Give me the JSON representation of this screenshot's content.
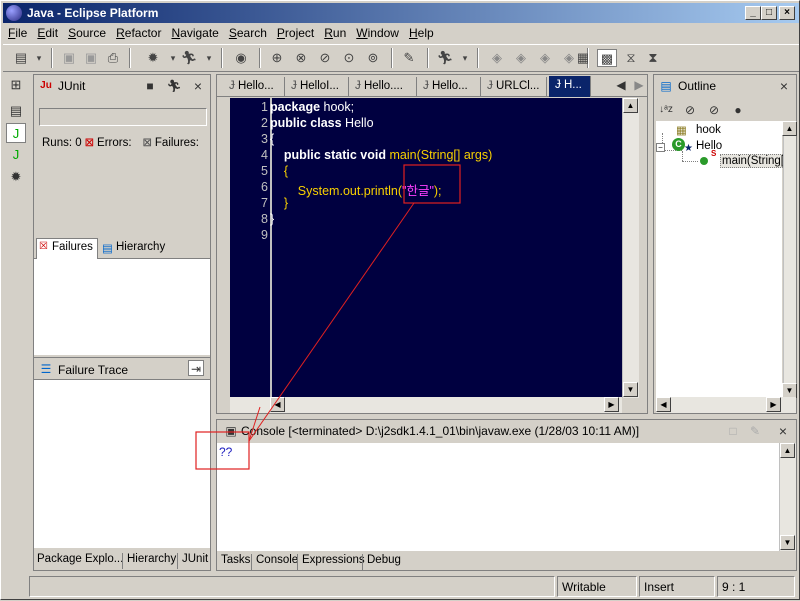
{
  "window": {
    "title": "Java - Eclipse Platform",
    "minimize_glyph": "_",
    "maximize_glyph": "□",
    "close_glyph": "×"
  },
  "menu": {
    "items": [
      "File",
      "Edit",
      "Source",
      "Refactor",
      "Navigate",
      "Search",
      "Project",
      "Run",
      "Window",
      "Help"
    ]
  },
  "junit": {
    "title": "JUnit",
    "runs_label": "Runs:",
    "runs_value": "0",
    "errors_label": "Errors:",
    "failures_label": "Failures:",
    "tab_failures": "Failures",
    "tab_hierarchy": "Hierarchy",
    "trace_title": "Failure Trace",
    "bottom_tabs": [
      "Package Explo...",
      "Hierarchy",
      "JUnit"
    ]
  },
  "editor": {
    "tabs": [
      "Hello...",
      "HelloI...",
      "Hello....",
      "Hello...",
      "URLCl...",
      "H..."
    ],
    "active_tab_index": 5,
    "lines": [
      {
        "num": "1",
        "kw": "package",
        "rest": " hook;"
      },
      {
        "num": "2",
        "kw": "public class",
        "rest": " Hello"
      },
      {
        "num": "3",
        "rest": "{"
      },
      {
        "num": "4",
        "indent": "    ",
        "kw": "public static void",
        "id": " main(String[] args)"
      },
      {
        "num": "5",
        "indent": "    ",
        "id": "{"
      },
      {
        "num": "6",
        "indent": "        ",
        "id": "System.out.println(",
        "str": "\"한글\"",
        "tail": ");"
      },
      {
        "num": "7",
        "indent": "    ",
        "id": "}"
      },
      {
        "num": "8",
        "rest": "}"
      },
      {
        "num": "9",
        "rest": ""
      }
    ]
  },
  "outline": {
    "title": "Outline",
    "items": [
      {
        "label": "hook",
        "level": 0
      },
      {
        "label": "Hello",
        "level": 0
      },
      {
        "label": "main(String[])",
        "level": 1
      }
    ]
  },
  "console": {
    "title": "Console [<terminated> D:\\j2sdk1.4.1_01\\bin\\javaw.exe (1/28/03 10:11 AM)]",
    "output": "??",
    "bottom_tabs": [
      "Tasks",
      "Console",
      "Expressions",
      "Debug"
    ]
  },
  "status": {
    "writable": "Writable",
    "insert": "Insert",
    "position": "9 : 1"
  },
  "colors": {
    "editor_bg": "#000040",
    "keyword": "#ffffff",
    "identifier": "#f8d000",
    "string": "#ff40ff",
    "annotation": "#e02020",
    "title_bar": "#0a246a"
  }
}
